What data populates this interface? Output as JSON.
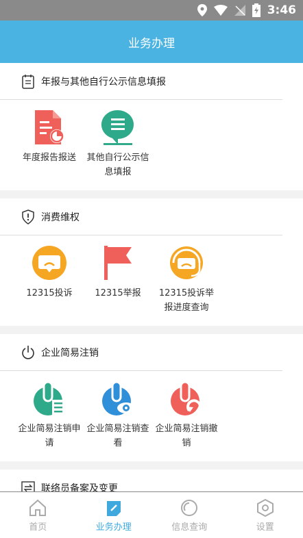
{
  "status": {
    "time": "3:46"
  },
  "header": {
    "title": "业务办理"
  },
  "sections": [
    {
      "title": "年报与其他自行公示信息填报",
      "items": [
        {
          "label": "年度报告报送",
          "icon": "report-doc-icon"
        },
        {
          "label": "其他自行公示信息填报",
          "icon": "chat-list-icon"
        }
      ]
    },
    {
      "title": "消费维权",
      "items": [
        {
          "label": "12315投诉",
          "icon": "complaint-bubble-icon"
        },
        {
          "label": "12315举报",
          "icon": "flag-icon"
        },
        {
          "label": "12315投诉举报进度查询",
          "icon": "progress-headset-icon"
        }
      ]
    },
    {
      "title": "企业简易注销",
      "items": [
        {
          "label": "企业简易注销申请",
          "icon": "cancel-apply-icon"
        },
        {
          "label": "企业简易注销查看",
          "icon": "cancel-view-icon"
        },
        {
          "label": "企业简易注销撤销",
          "icon": "cancel-revoke-icon"
        }
      ]
    },
    {
      "title": "联络员备案及变更",
      "items": []
    }
  ],
  "tabs": [
    {
      "label": "首页",
      "icon": "home-icon"
    },
    {
      "label": "业务办理",
      "icon": "business-icon"
    },
    {
      "label": "信息查询",
      "icon": "info-query-icon"
    },
    {
      "label": "设置",
      "icon": "settings-icon"
    }
  ],
  "colors": {
    "accent": "#4ab3e2",
    "red": "#f0605a",
    "teal": "#2eaa8a",
    "orange": "#f5a623",
    "blue": "#2f8fd8"
  }
}
